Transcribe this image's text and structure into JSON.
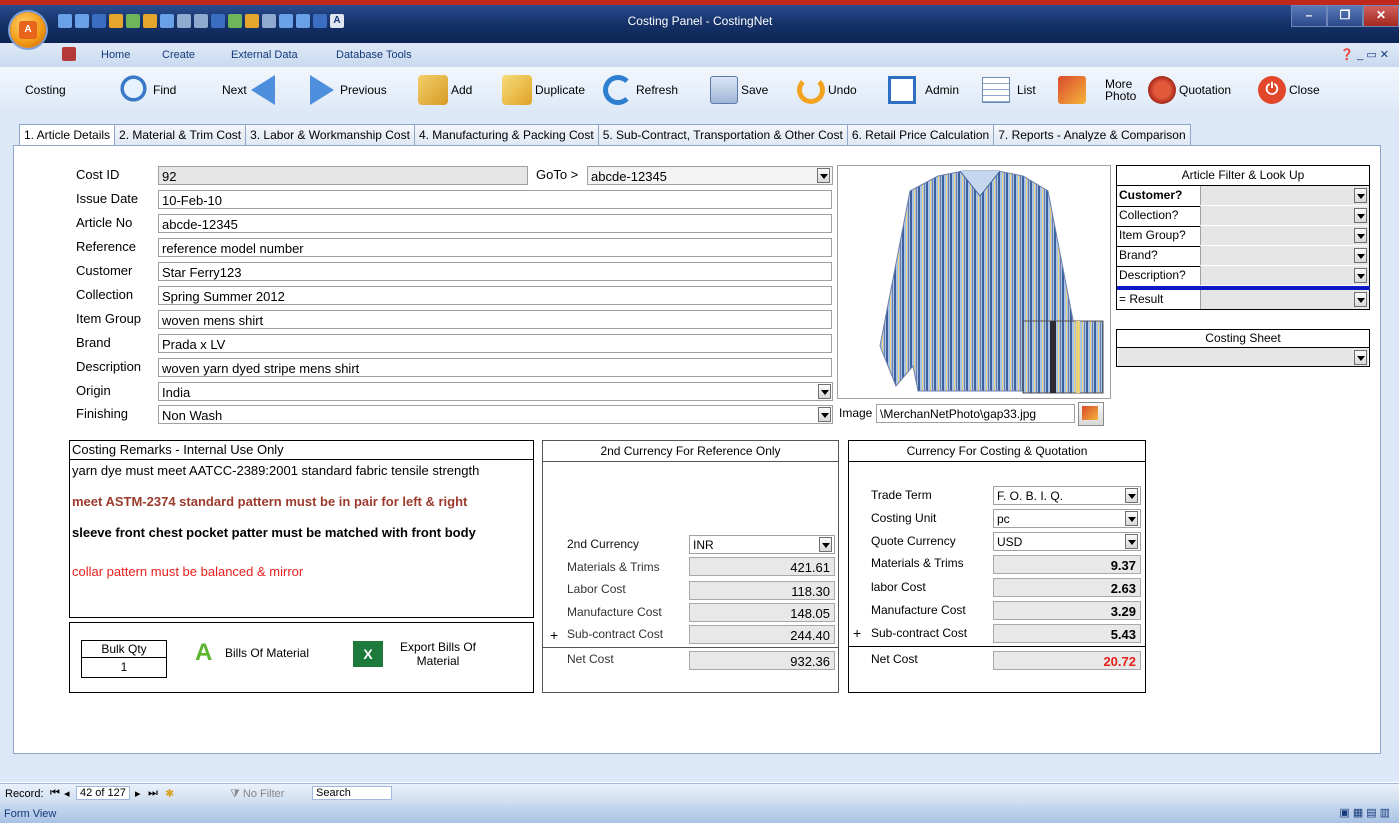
{
  "window": {
    "title": "Costing Panel - CostingNet"
  },
  "ribbon_tabs": [
    "Home",
    "Create",
    "External Data",
    "Database Tools"
  ],
  "toolbar": {
    "section_label": "Costing",
    "find": "Find",
    "next": "Next",
    "previous": "Previous",
    "add": "Add",
    "duplicate": "Duplicate",
    "refresh": "Refresh",
    "save": "Save",
    "undo": "Undo",
    "admin": "Admin",
    "list": "List",
    "more_photo_1": "More",
    "more_photo_2": "Photo",
    "quotation": "Quotation",
    "close": "Close"
  },
  "form_tabs": [
    "1. Article Details",
    "2. Material & Trim Cost",
    "3. Labor & Workmanship Cost",
    "4. Manufacturing & Packing Cost",
    "5. Sub-Contract, Transportation & Other Cost",
    "6. Retail Price Calculation",
    "7. Reports - Analyze & Comparison"
  ],
  "article": {
    "cost_id_label": "Cost ID",
    "cost_id": "92",
    "goto_label": "GoTo >",
    "goto_value": "abcde-12345",
    "issue_date_label": "Issue Date",
    "issue_date": "10-Feb-10",
    "article_no_label": "Article No",
    "article_no": "abcde-12345",
    "reference_label": "Reference",
    "reference": "reference model number",
    "customer_label": "Customer",
    "customer": "Star Ferry123",
    "collection_label": "Collection",
    "collection": "Spring Summer 2012",
    "item_group_label": "Item Group",
    "item_group": "woven mens shirt",
    "brand_label": "Brand",
    "brand": "Prada x LV",
    "description_label": "Description",
    "description": "woven yarn dyed stripe mens shirt",
    "origin_label": "Origin",
    "origin": "India",
    "finishing_label": "Finishing",
    "finishing": "Non Wash",
    "image_label": "Image",
    "image_path": "\\MerchanNetPhoto\\gap33.jpg"
  },
  "filter": {
    "title": "Article Filter & Look Up",
    "rows": [
      "Customer?",
      "Collection?",
      "Item Group?",
      "Brand?",
      "Description?"
    ],
    "result": "= Result",
    "costing_sheet_title": "Costing Sheet"
  },
  "remarks": {
    "title": "Costing Remarks - Internal Use Only",
    "lines": [
      {
        "text": "yarn dye must meet AATCC-2389:2001 standard fabric tensile strength",
        "color": "#000000",
        "bold": false
      },
      {
        "text": "meet ASTM-2374 standard pattern must be in pair for left & right",
        "color": "#9b3b2d",
        "bold": true
      },
      {
        "text": "sleeve front chest pocket patter must be matched with front body",
        "color": "#000000",
        "bold": true
      },
      {
        "text": "collar pattern must be balanced & mirror",
        "color": "#e8201c",
        "bold": false
      }
    ]
  },
  "bulk": {
    "label": "Bulk Qty",
    "value": "1",
    "bom": "Bills Of Material",
    "export_1": "Export Bills Of",
    "export_2": "Material"
  },
  "second_currency": {
    "title": "2nd Currency For Reference Only",
    "currency_label": "2nd Currency",
    "currency": "INR",
    "materials_label": "Materials & Trims",
    "materials": "421.61",
    "labor_label": "Labor Cost",
    "labor": "118.30",
    "manufacture_label": "Manufacture Cost",
    "manufacture": "148.05",
    "subcontract_label": "Sub-contract Cost",
    "subcontract": "244.40",
    "net_label": "Net Cost",
    "net": "932.36",
    "plus": "+"
  },
  "costing_currency": {
    "title": "Currency For Costing & Quotation",
    "trade_term_label": "Trade Term",
    "trade_term": "F. O. B. I. Q.",
    "unit_label": "Costing Unit",
    "unit": "pc",
    "quote_label": "Quote Currency",
    "quote": "USD",
    "materials_label": "Materials & Trims",
    "materials": "9.37",
    "labor_label": "labor Cost",
    "labor": "2.63",
    "manufacture_label": "Manufacture Cost",
    "manufacture": "3.29",
    "subcontract_label": "Sub-contract Cost",
    "subcontract": "5.43",
    "net_label": "Net Cost",
    "net": "20.72",
    "net_color": "#e8201c",
    "plus": "+"
  },
  "record_nav": {
    "label": "Record:",
    "position": "42 of 127",
    "filter": "No Filter",
    "search": "Search"
  },
  "status": {
    "view": "Form View"
  }
}
